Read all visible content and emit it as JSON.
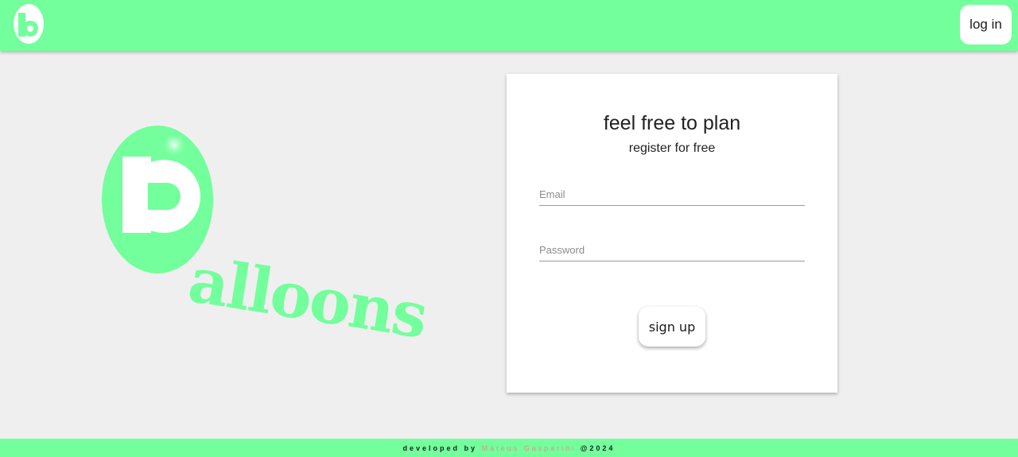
{
  "header": {
    "logo_icon": "balloon-b-logo-icon",
    "login_label": "log in"
  },
  "hero": {
    "logo_text": "alloons",
    "logo_icon": "balloon-b-icon"
  },
  "card": {
    "title": "feel free to plan",
    "subtitle": "register for free",
    "email_placeholder": "Email",
    "email_value": "",
    "password_placeholder": "Password",
    "password_value": "",
    "signup_label": "sign up"
  },
  "footer": {
    "prefix": "developed by",
    "author": "Mateus Gasparini",
    "suffix": "@2024"
  },
  "colors": {
    "brand_green": "#72ff9c",
    "background": "#efefef",
    "author_pink": "#f08a8a"
  }
}
